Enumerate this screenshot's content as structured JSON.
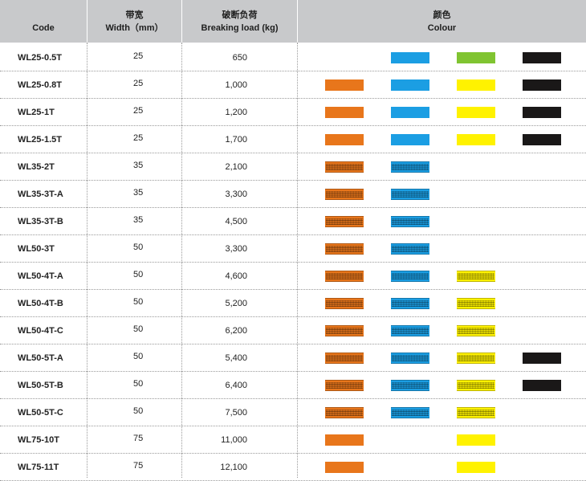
{
  "header": {
    "code": "Code",
    "width_cn": "带宽",
    "width_en": "Width（mm）",
    "load_cn": "破断负荷",
    "load_en": "Breaking load (kg)",
    "colour_cn": "颜色",
    "colour_en": "Colour"
  },
  "palette": {
    "orange": "#e8761b",
    "blue": "#1b9ee3",
    "green": "#80c431",
    "yellow": "#fff200",
    "black": "#1a1818"
  },
  "rows": [
    {
      "code": "WL25-0.5T",
      "width": "25",
      "load": "650",
      "colours": [
        null,
        "blue",
        "green",
        "black"
      ],
      "webbing": false
    },
    {
      "code": "WL25-0.8T",
      "width": "25",
      "load": "1,000",
      "colours": [
        "orange",
        "blue",
        "yellow",
        "black"
      ],
      "webbing": false
    },
    {
      "code": "WL25-1T",
      "width": "25",
      "load": "1,200",
      "colours": [
        "orange",
        "blue",
        "yellow",
        "black"
      ],
      "webbing": false
    },
    {
      "code": "WL25-1.5T",
      "width": "25",
      "load": "1,700",
      "colours": [
        "orange",
        "blue",
        "yellow",
        "black"
      ],
      "webbing": false
    },
    {
      "code": "WL35-2T",
      "width": "35",
      "load": "2,100",
      "colours": [
        "orange",
        "blue",
        null,
        null
      ],
      "webbing": true
    },
    {
      "code": "WL35-3T-A",
      "width": "35",
      "load": "3,300",
      "colours": [
        "orange",
        "blue",
        null,
        null
      ],
      "webbing": true
    },
    {
      "code": "WL35-3T-B",
      "width": "35",
      "load": "4,500",
      "colours": [
        "orange",
        "blue",
        null,
        null
      ],
      "webbing": true
    },
    {
      "code": "WL50-3T",
      "width": "50",
      "load": "3,300",
      "colours": [
        "orange",
        "blue",
        null,
        null
      ],
      "webbing": true
    },
    {
      "code": "WL50-4T-A",
      "width": "50",
      "load": "4,600",
      "colours": [
        "orange",
        "blue",
        "yellow",
        null
      ],
      "webbing": true
    },
    {
      "code": "WL50-4T-B",
      "width": "50",
      "load": "5,200",
      "colours": [
        "orange",
        "blue",
        "yellow",
        null
      ],
      "webbing": true
    },
    {
      "code": "WL50-4T-C",
      "width": "50",
      "load": "6,200",
      "colours": [
        "orange",
        "blue",
        "yellow",
        null
      ],
      "webbing": true
    },
    {
      "code": "WL50-5T-A",
      "width": "50",
      "load": "5,400",
      "colours": [
        "orange",
        "blue",
        "yellow",
        "black"
      ],
      "webbing": true
    },
    {
      "code": "WL50-5T-B",
      "width": "50",
      "load": "6,400",
      "colours": [
        "orange",
        "blue",
        "yellow",
        "black"
      ],
      "webbing": true
    },
    {
      "code": "WL50-5T-C",
      "width": "50",
      "load": "7,500",
      "colours": [
        "orange",
        "blue",
        "yellow",
        null
      ],
      "webbing": true
    },
    {
      "code": "WL75-10T",
      "width": "75",
      "load": "11,000",
      "colours": [
        "orange",
        null,
        "yellow",
        null
      ],
      "webbing": false
    },
    {
      "code": "WL75-11T",
      "width": "75",
      "load": "12,100",
      "colours": [
        "orange",
        null,
        "yellow",
        null
      ],
      "webbing": false
    }
  ]
}
